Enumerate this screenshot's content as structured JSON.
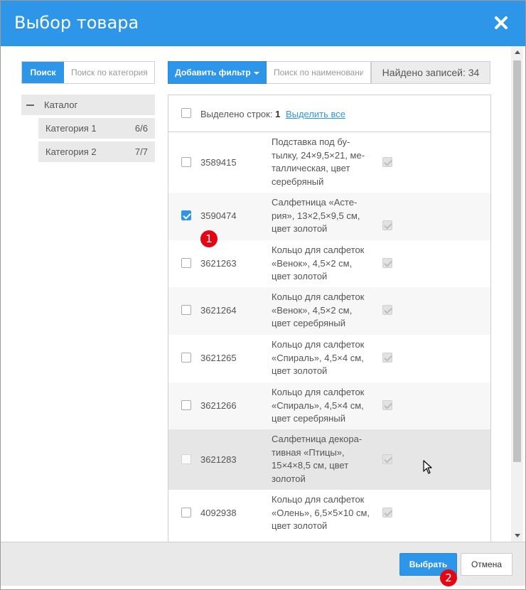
{
  "dialog": {
    "title": "Выбор товара",
    "close_icon": "close-icon",
    "accent_color": "#2d96e8"
  },
  "left_panel": {
    "search_button": "Поиск",
    "search_placeholder": "Поиск по категориям",
    "tree_root": "Каталог",
    "categories": [
      {
        "label": "Категория 1",
        "count": "6/6"
      },
      {
        "label": "Категория 2",
        "count": "7/7"
      }
    ]
  },
  "toolbar": {
    "add_filter": "Добавить фильтр",
    "name_placeholder": "Поиск по наименованию",
    "found": "Найдено записей: 34"
  },
  "table": {
    "selected_label": "Выделено строк:",
    "selected_count": "1",
    "select_all": "Выделить все",
    "rows": [
      {
        "code": "3589415",
        "name": "Подставка под бу-тылку, 24×9,5×21, ме-таллическая, цвет серебряный",
        "checked": false
      },
      {
        "code": "3590474",
        "name": "Салфетница «Асте-рия», 13×2,5×9,5 см, цвет золотой",
        "checked": true
      },
      {
        "code": "3621263",
        "name": "Кольцо для салфеток «Венок», 4,5×2 см, цвет золотой",
        "checked": false
      },
      {
        "code": "3621264",
        "name": "Кольцо для салфеток «Венок», 4,5×2 см, цвет серебряный",
        "checked": false
      },
      {
        "code": "3621265",
        "name": "Кольцо для салфеток «Спираль», 4,5×4 см, цвет золотой",
        "checked": false
      },
      {
        "code": "3621266",
        "name": "Кольцо для салфеток «Спираль», 4,5×4 см, цвет серебряный",
        "checked": false
      },
      {
        "code": "3621283",
        "name": "Салфетница декора-тивная «Птицы», 15×4×8,5 см, цвет золотой",
        "checked": false
      },
      {
        "code": "4092938",
        "name": "Кольцо для салфеток «Олень», 6,5×5×10 см, цвет золотой",
        "checked": false
      }
    ]
  },
  "footer": {
    "select_button": "Выбрать",
    "cancel_button": "Отмена"
  },
  "markers": [
    "1",
    "2"
  ]
}
